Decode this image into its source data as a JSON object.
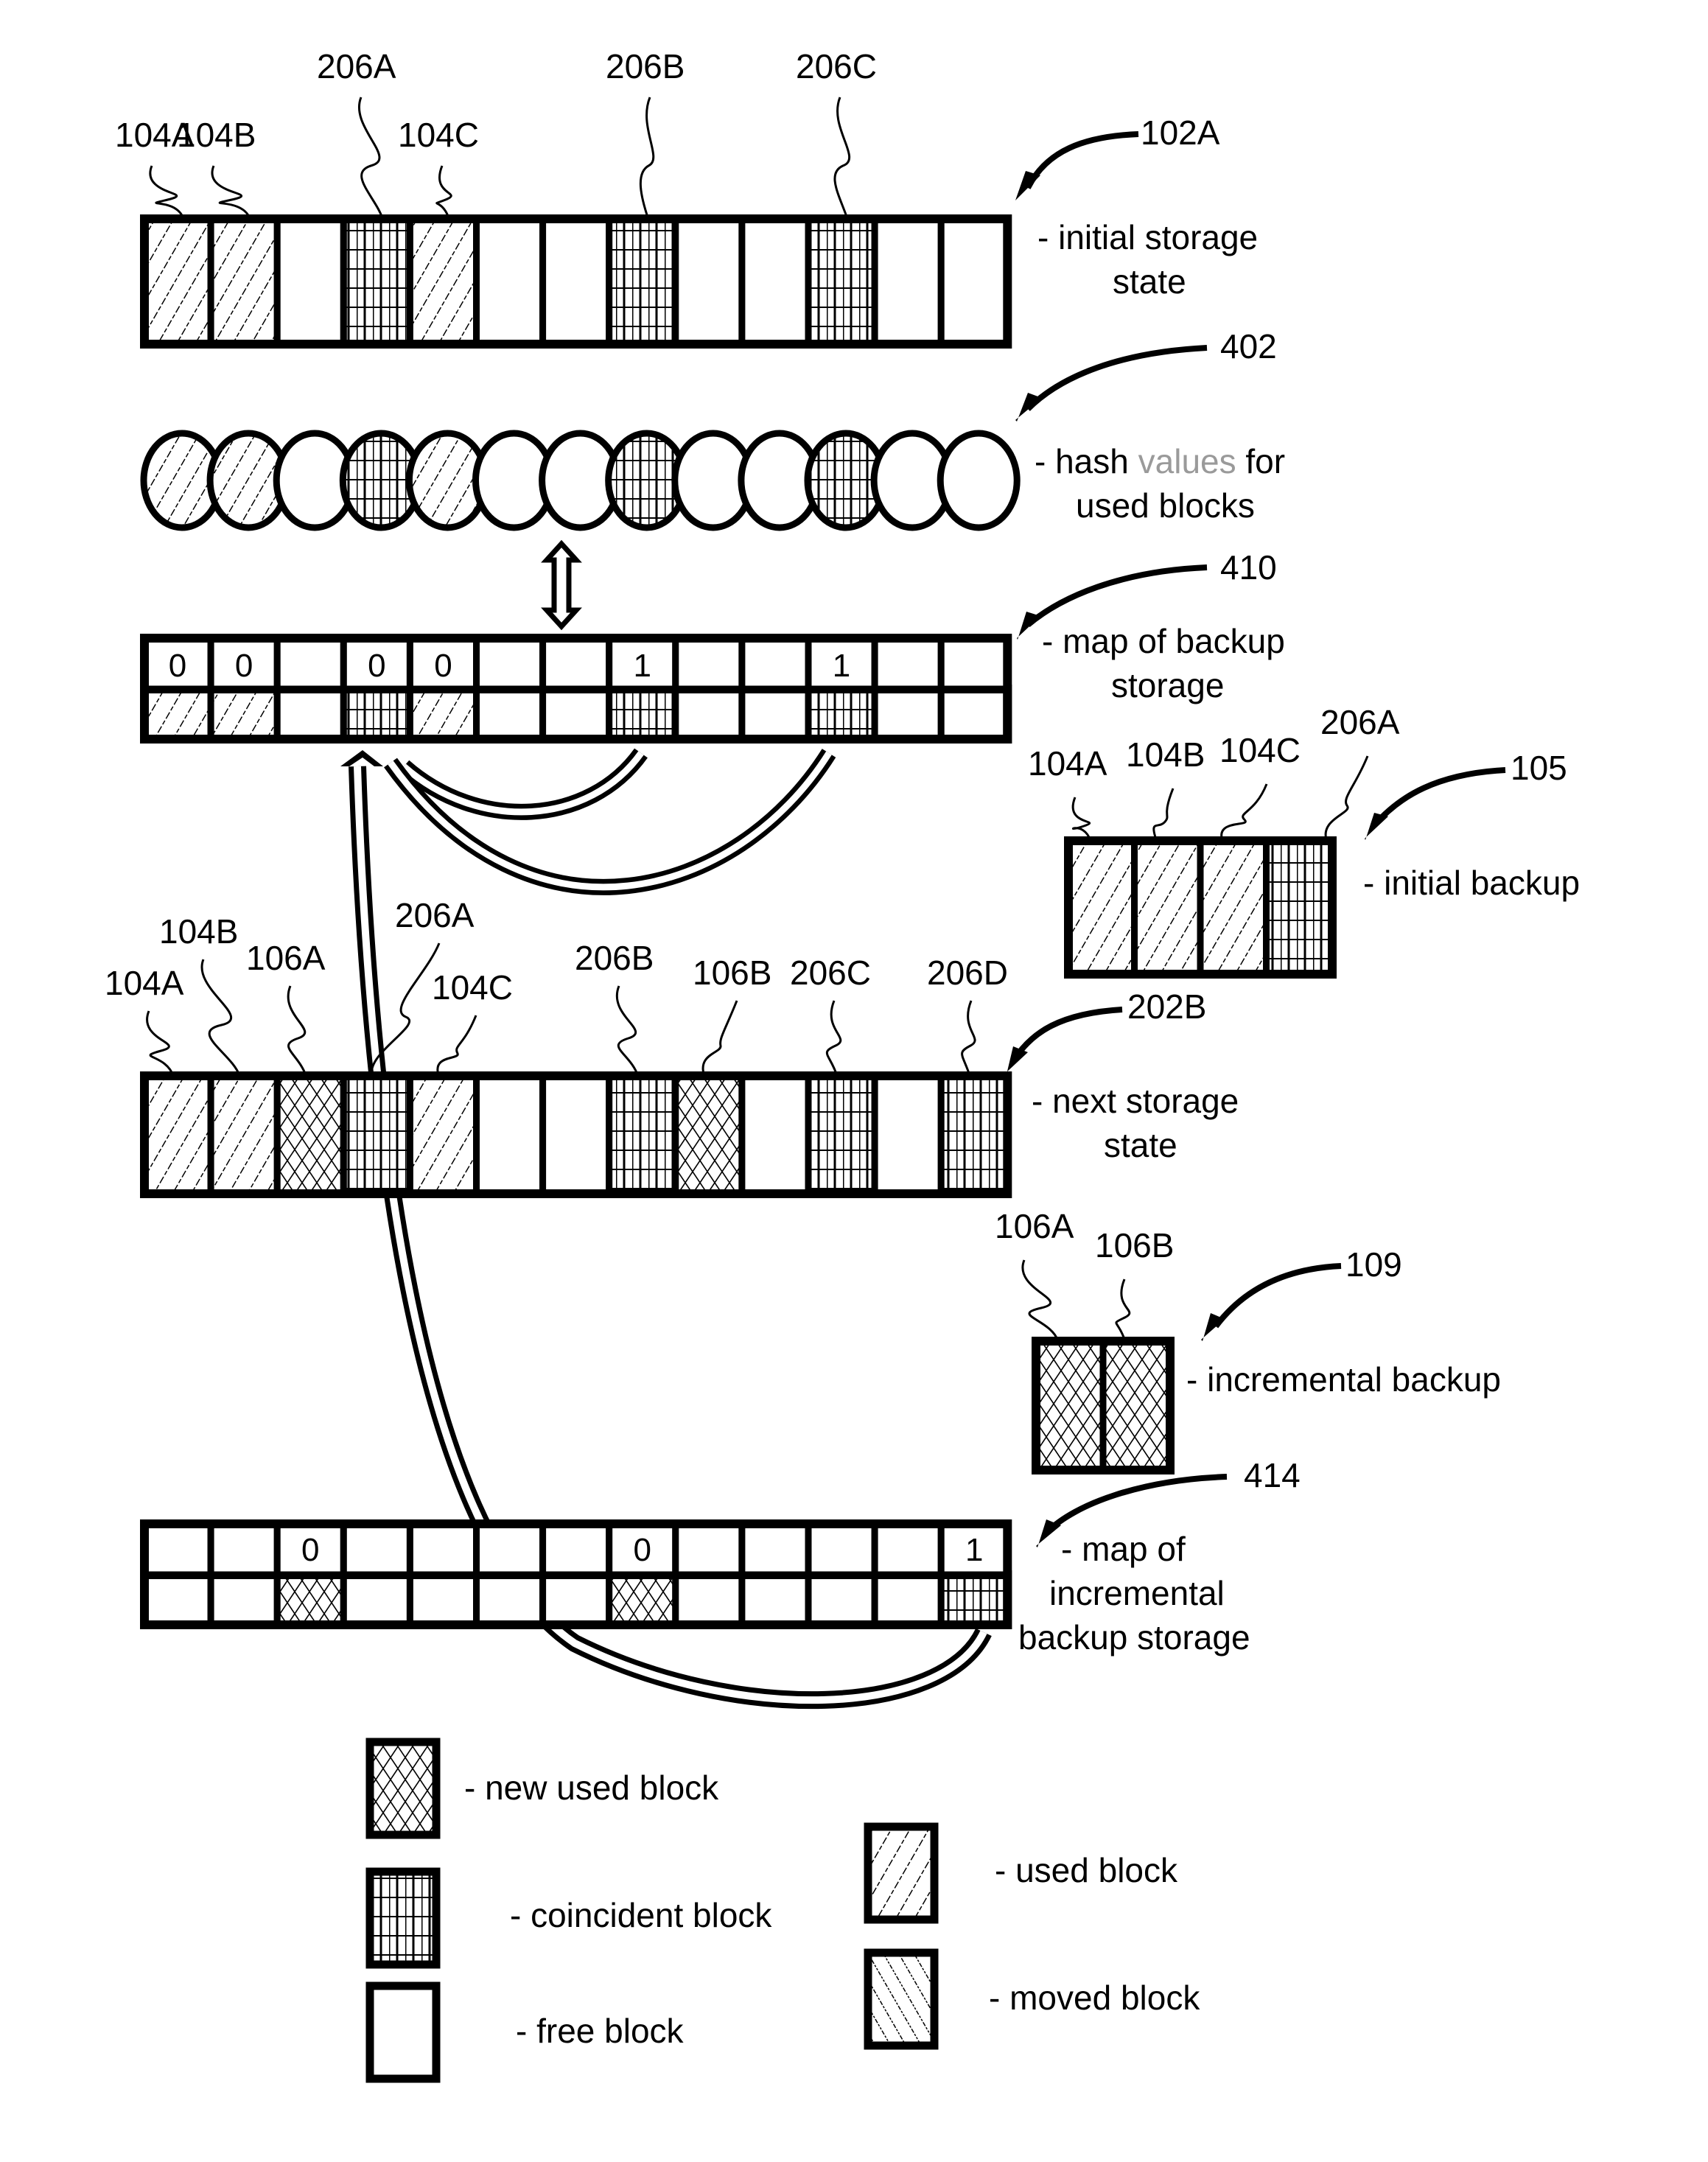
{
  "figure": {
    "rows": {
      "initial_storage": {
        "ref": "102A",
        "desc_lines": [
          "- initial storage",
          "state"
        ],
        "cells": [
          "used",
          "used",
          "free",
          "coincident",
          "used",
          "free",
          "free",
          "coincident",
          "free",
          "free",
          "coincident",
          "free",
          "free"
        ],
        "labels": [
          {
            "text": "104A",
            "cell": 0
          },
          {
            "text": "104B",
            "cell": 1
          },
          {
            "text": "206A",
            "cell": 3
          },
          {
            "text": "104C",
            "cell": 4
          },
          {
            "text": "206B",
            "cell": 7
          },
          {
            "text": "206C",
            "cell": 10
          }
        ]
      },
      "hash_values": {
        "ref": "402",
        "desc_line1_pre": "- hash ",
        "desc_line1_faded": "values",
        "desc_line1_post": " for",
        "desc_line2": "used blocks",
        "cells": [
          "used",
          "used",
          "free",
          "coincident",
          "used",
          "free",
          "free",
          "coincident",
          "free",
          "free",
          "coincident",
          "free",
          "free"
        ]
      },
      "backup_map": {
        "ref": "410",
        "desc_lines": [
          "- map of backup",
          "storage"
        ],
        "bits": [
          "0",
          "0",
          "",
          "0",
          "0",
          "",
          "",
          "1",
          "",
          "",
          "1",
          "",
          ""
        ],
        "cells": [
          "used",
          "used",
          "free",
          "coincident",
          "used",
          "free",
          "free",
          "coincident",
          "free",
          "free",
          "coincident",
          "free",
          "free"
        ]
      },
      "initial_backup": {
        "ref": "105",
        "desc": "- initial backup",
        "cells": [
          "used",
          "used",
          "used",
          "coincident"
        ],
        "labels": [
          "104A",
          "104B",
          "104C",
          "206A"
        ]
      },
      "next_storage": {
        "ref": "202B",
        "desc_lines": [
          "- next storage",
          "state"
        ],
        "cells": [
          "used",
          "used",
          "new",
          "coincident",
          "used",
          "free",
          "free",
          "coincident",
          "new",
          "free",
          "coincident",
          "free",
          "coincident"
        ],
        "labels": [
          {
            "text": "104A",
            "cell": 0
          },
          {
            "text": "104B",
            "cell": 1
          },
          {
            "text": "106A",
            "cell": 2
          },
          {
            "text": "206A",
            "cell": 3
          },
          {
            "text": "104C",
            "cell": 4
          },
          {
            "text": "206B",
            "cell": 7
          },
          {
            "text": "106B",
            "cell": 8
          },
          {
            "text": "206C",
            "cell": 10
          },
          {
            "text": "206D",
            "cell": 12
          }
        ]
      },
      "incremental_backup": {
        "ref": "109",
        "desc": "- incremental backup",
        "cells": [
          "new",
          "new"
        ],
        "labels": [
          "106A",
          "106B"
        ]
      },
      "incremental_map": {
        "ref": "414",
        "desc_lines": [
          "- map of",
          "incremental",
          "backup storage"
        ],
        "bits": [
          "",
          "",
          "0",
          "",
          "",
          "",
          "",
          "0",
          "",
          "",
          "",
          "",
          "1"
        ],
        "cells": [
          "free",
          "free",
          "new",
          "free",
          "free",
          "free",
          "free",
          "new",
          "free",
          "free",
          "free",
          "free",
          "coincident"
        ]
      }
    },
    "legend": [
      {
        "type": "new",
        "label": "- new used block"
      },
      {
        "type": "coincident",
        "label": "- coincident block"
      },
      {
        "type": "free",
        "label": "- free block"
      },
      {
        "type": "used",
        "label": "- used block"
      },
      {
        "type": "moved",
        "label": "- moved block"
      }
    ],
    "colors": {
      "ink": "#000000",
      "paper": "#ffffff",
      "faded_text": "#9a9a9a"
    }
  }
}
